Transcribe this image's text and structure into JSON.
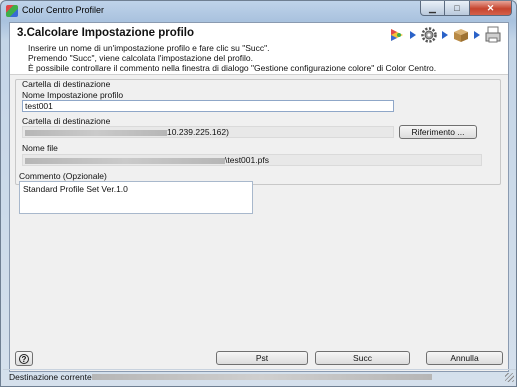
{
  "window": {
    "title": "Color Centro Profiler"
  },
  "header": {
    "step_title": "3.Calcolare Impostazione profilo",
    "lines": [
      "Inserire un nome di un'impostazione profilo e fare clic su \"Succ\".",
      "Premendo \"Succ\", viene calcolata l'impostazione del profilo.",
      "È possibile controllare il commento nella finestra di dialogo \"Gestione configurazione colore\" di Color Centro."
    ]
  },
  "destination": {
    "group_label": "Cartella di destinazione",
    "name_label": "Nome Impostazione profilo",
    "name_value": "test001",
    "folder_label": "Cartella di destinazione",
    "folder_value_visible": "10.239.225.162)",
    "browse_label": "Riferimento ...",
    "file_label": "Nome file",
    "file_value_visible": "\\test001.pfs"
  },
  "comment": {
    "label": "Commento (Opzionale)",
    "value": "Standard Profile Set Ver.1.0"
  },
  "footer": {
    "prev_label": "Pst",
    "next_label": "Succ",
    "cancel_label": "Annulla",
    "help_symbol": "?"
  },
  "status": {
    "label": "Destinazione corrente"
  },
  "icons": {
    "app": "color-centro-icon",
    "steps": [
      "color-profile-icon",
      "gear-icon",
      "package-icon",
      "printer-icon"
    ]
  },
  "colors": {
    "accent": "#2a62c8",
    "close": "#c6452f"
  }
}
